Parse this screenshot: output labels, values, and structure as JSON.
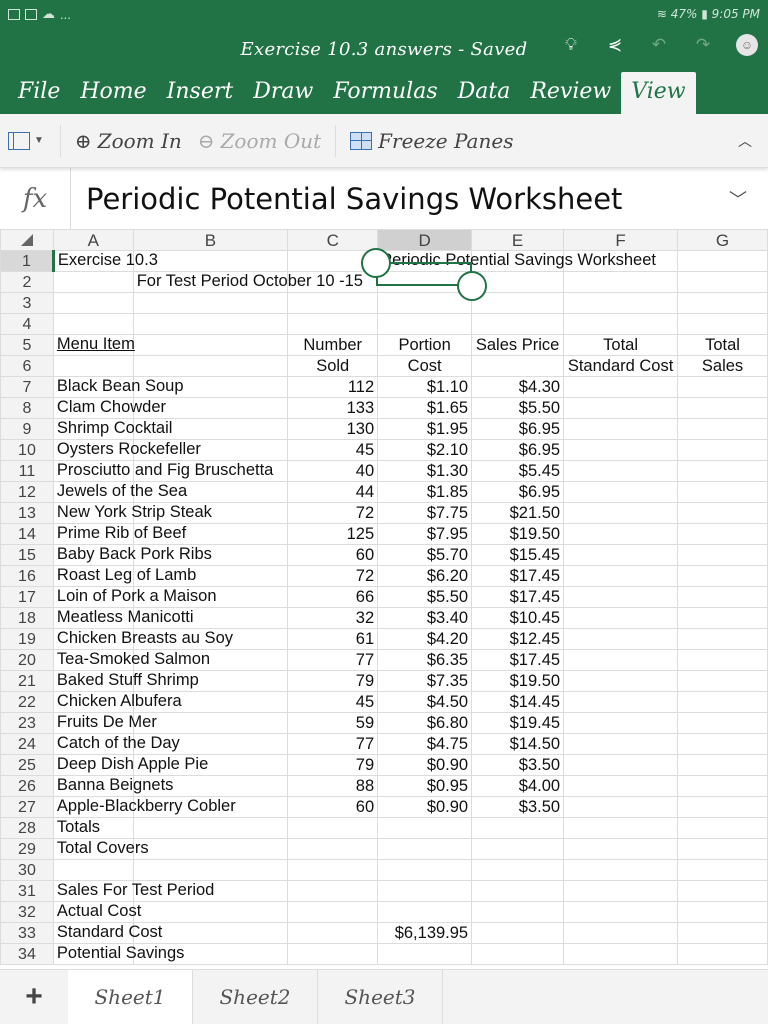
{
  "status_bar": {
    "left_icons": [
      "gmail-icon",
      "gmail-icon",
      "cloud-icon"
    ],
    "overflow": "...",
    "battery": "47%",
    "time": "9:05 PM"
  },
  "title_bar": {
    "title": "Exercise 10.3 answers - Saved",
    "icons": [
      "lightbulb-icon",
      "share-icon",
      "undo-icon",
      "redo-icon",
      "account-icon"
    ]
  },
  "ribbon_tabs": [
    {
      "label": "File",
      "active": false
    },
    {
      "label": "Home",
      "active": false
    },
    {
      "label": "Insert",
      "active": false
    },
    {
      "label": "Draw",
      "active": false
    },
    {
      "label": "Formulas",
      "active": false
    },
    {
      "label": "Data",
      "active": false
    },
    {
      "label": "Review",
      "active": false
    },
    {
      "label": "View",
      "active": true
    }
  ],
  "ribbon": {
    "zoom_in": "Zoom In",
    "zoom_out": "Zoom Out",
    "freeze_panes": "Freeze Panes"
  },
  "formula_bar": {
    "fx": "fx",
    "content": "Periodic Potential Savings Worksheet"
  },
  "columns": [
    "A",
    "B",
    "C",
    "D",
    "E",
    "F",
    "G"
  ],
  "selected_cell": "D1",
  "sheet": {
    "r1": {
      "num": "1",
      "a": "Exercise 10.3",
      "d": "Periodic Potential Savings Worksheet"
    },
    "r2": {
      "num": "2",
      "b": "For Test Period October 10 -15"
    },
    "r3": {
      "num": "3"
    },
    "r4": {
      "num": "4"
    },
    "r5": {
      "num": "5",
      "a": "Menu Item",
      "c": "Number",
      "d": "Portion",
      "e": "Sales Price",
      "f": "Total",
      "g": "Total"
    },
    "r6": {
      "num": "6",
      "c": "Sold",
      "d": "Cost",
      "f": "Standard Cost",
      "g": "Sales"
    },
    "items": [
      {
        "num": "7",
        "item": "Black Bean Soup",
        "sold": "112",
        "cost": "$1.10",
        "price": "$4.30"
      },
      {
        "num": "8",
        "item": "Clam Chowder",
        "sold": "133",
        "cost": "$1.65",
        "price": "$5.50"
      },
      {
        "num": "9",
        "item": "Shrimp Cocktail",
        "sold": "130",
        "cost": "$1.95",
        "price": "$6.95"
      },
      {
        "num": "10",
        "item": "Oysters Rockefeller",
        "sold": "45",
        "cost": "$2.10",
        "price": "$6.95"
      },
      {
        "num": "11",
        "item": "Prosciutto and Fig Bruschetta",
        "sold": "40",
        "cost": "$1.30",
        "price": "$5.45"
      },
      {
        "num": "12",
        "item": "Jewels of the Sea",
        "sold": "44",
        "cost": "$1.85",
        "price": "$6.95"
      },
      {
        "num": "13",
        "item": "New York Strip Steak",
        "sold": "72",
        "cost": "$7.75",
        "price": "$21.50"
      },
      {
        "num": "14",
        "item": "Prime Rib of Beef",
        "sold": "125",
        "cost": "$7.95",
        "price": "$19.50"
      },
      {
        "num": "15",
        "item": "Baby Back Pork Ribs",
        "sold": "60",
        "cost": "$5.70",
        "price": "$15.45"
      },
      {
        "num": "16",
        "item": "Roast Leg of Lamb",
        "sold": "72",
        "cost": "$6.20",
        "price": "$17.45"
      },
      {
        "num": "17",
        "item": "Loin of Pork a Maison",
        "sold": "66",
        "cost": "$5.50",
        "price": "$17.45"
      },
      {
        "num": "18",
        "item": "Meatless Manicotti",
        "sold": "32",
        "cost": "$3.40",
        "price": "$10.45"
      },
      {
        "num": "19",
        "item": "Chicken Breasts au Soy",
        "sold": "61",
        "cost": "$4.20",
        "price": "$12.45"
      },
      {
        "num": "20",
        "item": "Tea-Smoked Salmon",
        "sold": "77",
        "cost": "$6.35",
        "price": "$17.45"
      },
      {
        "num": "21",
        "item": "Baked Stuff Shrimp",
        "sold": "79",
        "cost": "$7.35",
        "price": "$19.50"
      },
      {
        "num": "22",
        "item": "Chicken Albufera",
        "sold": "45",
        "cost": "$4.50",
        "price": "$14.45"
      },
      {
        "num": "23",
        "item": "Fruits De Mer",
        "sold": "59",
        "cost": "$6.80",
        "price": "$19.45"
      },
      {
        "num": "24",
        "item": "Catch of the Day",
        "sold": "77",
        "cost": "$4.75",
        "price": "$14.50"
      },
      {
        "num": "25",
        "item": "Deep Dish Apple Pie",
        "sold": "79",
        "cost": "$0.90",
        "price": "$3.50"
      },
      {
        "num": "26",
        "item": "Banna Beignets",
        "sold": "88",
        "cost": "$0.95",
        "price": "$4.00"
      },
      {
        "num": "27",
        "item": "Apple-Blackberry Cobler",
        "sold": "60",
        "cost": "$0.90",
        "price": "$3.50"
      }
    ],
    "r28": {
      "num": "28",
      "a": "Totals"
    },
    "r29": {
      "num": "29",
      "a": "Total Covers"
    },
    "r30": {
      "num": "30"
    },
    "r31": {
      "num": "31",
      "a": "Sales For Test Period"
    },
    "r32": {
      "num": "32",
      "a": "Actual Cost"
    },
    "r33": {
      "num": "33",
      "a": "Standard Cost",
      "d": "$6,139.95"
    },
    "r34": {
      "num": "34",
      "a": "Potential Savings"
    }
  },
  "sheet_tabs": {
    "add": "+",
    "tabs": [
      {
        "label": "Sheet1",
        "active": true
      },
      {
        "label": "Sheet2",
        "active": false
      },
      {
        "label": "Sheet3",
        "active": false
      }
    ]
  }
}
